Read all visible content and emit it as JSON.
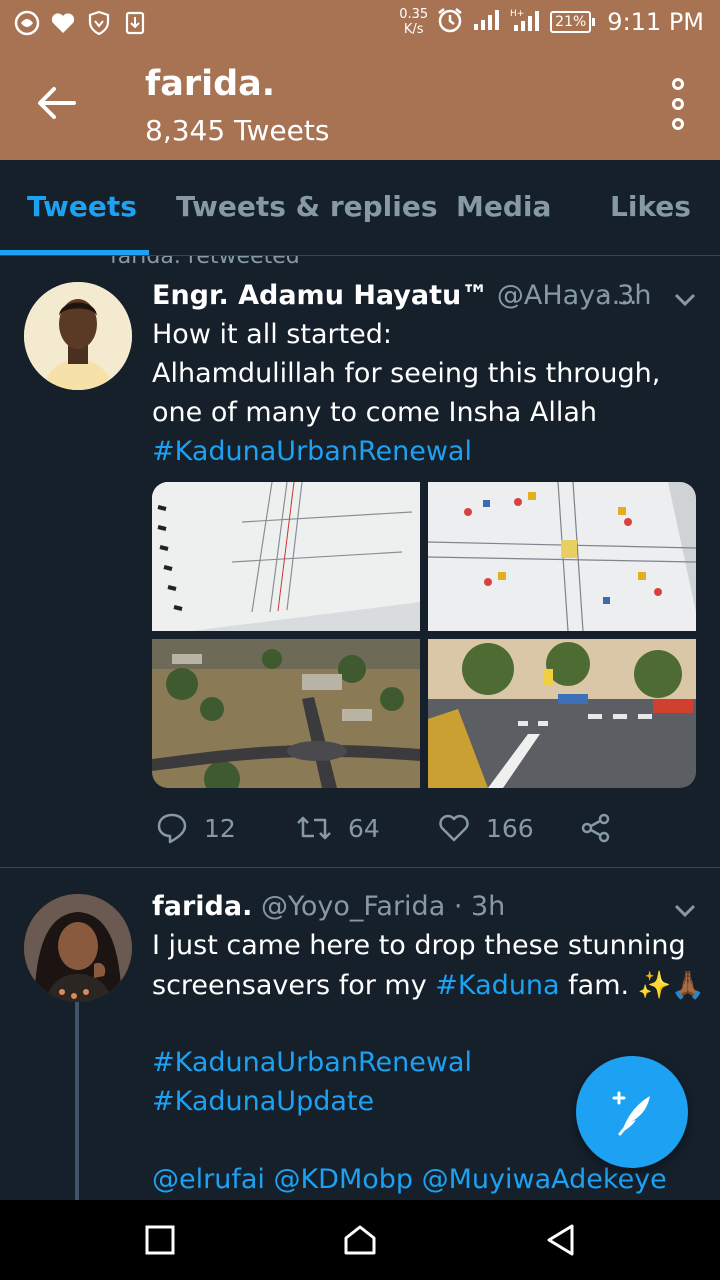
{
  "status_bar": {
    "speed_value": "0.35",
    "speed_unit": "K/s",
    "battery": "21%",
    "time": "9:11 PM"
  },
  "header": {
    "title": "farida.",
    "subtitle": "8,345 Tweets"
  },
  "tabs": [
    {
      "label": "Tweets",
      "active": true
    },
    {
      "label": "Tweets & replies",
      "active": false
    },
    {
      "label": "Media",
      "active": false
    },
    {
      "label": "Likes",
      "active": false
    }
  ],
  "feed": {
    "retweet_hint": "farida. retweeted",
    "tweets": [
      {
        "author": "Engr. Adamu Hayatu™",
        "handle": "@AHaya...",
        "time": "· 3h",
        "lines": [
          "How it all started:",
          "Alhamdulillah for seeing this through,",
          "one of many to come Insha Allah"
        ],
        "hashtag": "#KadunaUrbanRenewal",
        "replies": "12",
        "retweets": "64",
        "likes": "166"
      },
      {
        "author": "farida.",
        "handle": "@Yoyo_Farida",
        "time": "· 3h",
        "line1": "I just came here to drop these stunning",
        "line2_pre": "screensavers for my ",
        "line2_tag": "#Kaduna",
        "line2_post": " fam. ✨🙏🏾",
        "tag1": "#KadunaUrbanRenewal",
        "tag2": "#KadunaUpdate",
        "mentions": "@elrufai @KDMobp @MuyiwaAdekeye"
      }
    ]
  },
  "colors": {
    "accent": "#1da1f2",
    "header_bg": "#a87353",
    "background": "#15202b",
    "muted": "#8899a6"
  }
}
